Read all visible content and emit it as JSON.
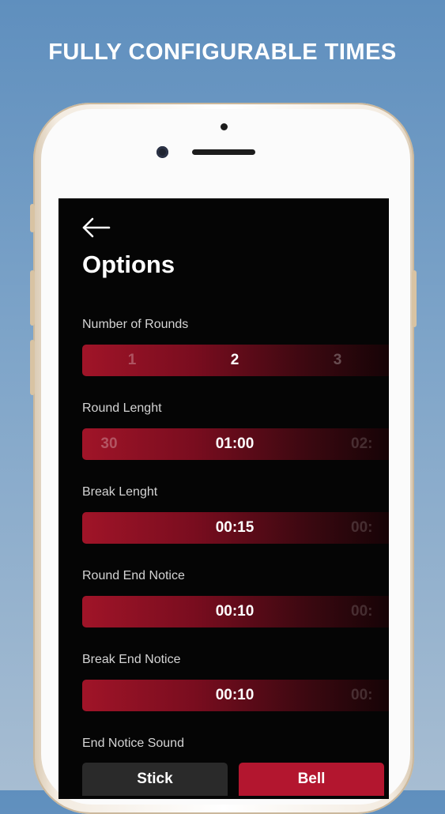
{
  "headline": "FULLY CONFIGURABLE TIMES",
  "screen": {
    "title": "Options",
    "sections": [
      {
        "label": "Number of Rounds",
        "prev": "1",
        "selected": "2",
        "next": "3"
      },
      {
        "label": "Round Lenght",
        "prev": "30",
        "selected": "01:00",
        "next": "02:"
      },
      {
        "label": "Break Lenght",
        "prev": "",
        "selected": "00:15",
        "next": "00:"
      },
      {
        "label": "Round End Notice",
        "prev": "",
        "selected": "00:10",
        "next": "00:"
      },
      {
        "label": "Break End Notice",
        "prev": "",
        "selected": "00:10",
        "next": "00:"
      }
    ],
    "end_notice_sound": {
      "label": "End Notice Sound",
      "options": [
        "Stick",
        "Bell"
      ],
      "selected": "Bell"
    }
  },
  "colors": {
    "accent": "#b3162f",
    "screen_bg": "#050505",
    "inactive_button": "#2a2a2a"
  },
  "icons": {
    "back": "arrow-left-icon"
  }
}
